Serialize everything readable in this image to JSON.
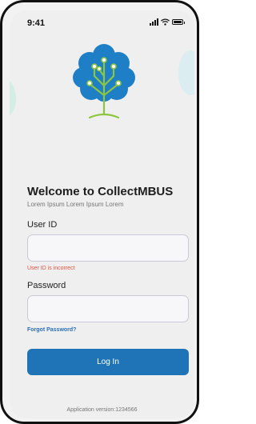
{
  "status_bar": {
    "time": "9:41"
  },
  "brand": {
    "logo_icon": "tree-circuit-logo",
    "leaf_color": "#1f7fc6",
    "trunk_color": "#8cc63f"
  },
  "welcome": {
    "title": "Welcome to CollectMBUS",
    "subtitle": "Lorem Ipsum Lorem Ipsum Lorem"
  },
  "form": {
    "user_id_label": "User ID",
    "user_id_value": "",
    "user_id_error": "User ID is incorrect",
    "password_label": "Password",
    "password_value": "",
    "forgot_password": "Forgot Password?",
    "login_button": "Log In"
  },
  "footer": {
    "version": "Application version:1234566"
  },
  "colors": {
    "primary": "#1f73b7",
    "error": "#e5533f",
    "link": "#2a6fb8"
  }
}
